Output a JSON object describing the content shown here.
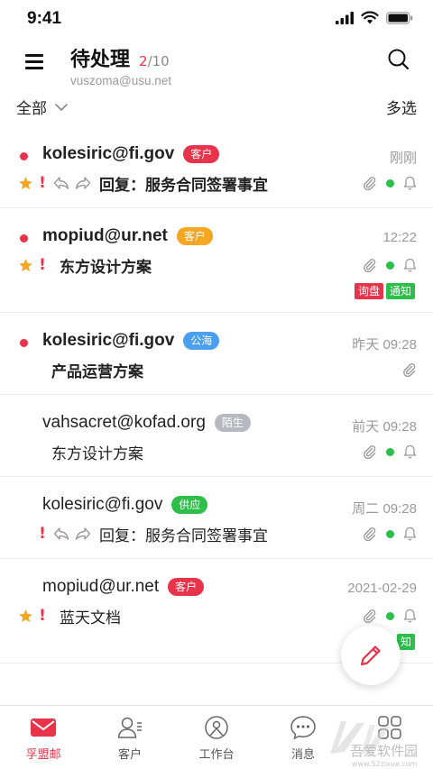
{
  "status_bar": {
    "time": "9:41"
  },
  "header": {
    "title": "待处理",
    "count_current": "2",
    "count_total": "/10",
    "account": "vuszoma@usu.net"
  },
  "filter": {
    "scope_label": "全部",
    "multi_select_label": "多选"
  },
  "colors": {
    "accent": "#e8334a",
    "green": "#2bbf4a",
    "orange": "#f5a623",
    "blue": "#4a9ff0",
    "grey": "#b8b8c0"
  },
  "mails": [
    {
      "sender": "kolesiric@fi.gov",
      "tag": "客户",
      "tag_color": "#e8334a",
      "time": "刚刚",
      "subject": "回复：服务合同签署事宜",
      "unread": true,
      "starred": true,
      "flagged": true,
      "reply_fwd": true,
      "status_dot": true,
      "bell": true,
      "badges": []
    },
    {
      "sender": "mopiud@ur.net",
      "tag": "客户",
      "tag_color": "#f5a623",
      "time": "12:22",
      "subject": "东方设计方案",
      "unread": true,
      "starred": true,
      "flagged": true,
      "reply_fwd": false,
      "status_dot": true,
      "bell": true,
      "badges": [
        {
          "label": "询盘",
          "color": "#e8334a"
        },
        {
          "label": "通知",
          "color": "#2bbf4a"
        }
      ]
    },
    {
      "sender": "kolesiric@fi.gov",
      "tag": "公海",
      "tag_color": "#4a9ff0",
      "time": "昨天 09:28",
      "subject": "产品运营方案",
      "unread": true,
      "starred": false,
      "flagged": false,
      "reply_fwd": false,
      "status_dot": false,
      "bell": false,
      "badges": []
    },
    {
      "sender": "vahsacret@kofad.org",
      "tag": "陌生",
      "tag_color": "#b8b8c0",
      "time": "前天 09:28",
      "subject": "东方设计方案",
      "unread": false,
      "starred": false,
      "flagged": false,
      "reply_fwd": false,
      "status_dot": true,
      "bell": true,
      "badges": []
    },
    {
      "sender": "kolesiric@fi.gov",
      "tag": "供应",
      "tag_color": "#2bbf4a",
      "time": "周二 09:28",
      "subject": "回复：服务合同签署事宜",
      "unread": false,
      "starred": false,
      "flagged": true,
      "reply_fwd": true,
      "status_dot": true,
      "bell": true,
      "badges": []
    },
    {
      "sender": "mopiud@ur.net",
      "tag": "客户",
      "tag_color": "#e8334a",
      "time": "2021-02-29",
      "subject": "蓝天文档",
      "unread": false,
      "starred": true,
      "flagged": true,
      "reply_fwd": false,
      "status_dot": true,
      "bell": true,
      "badges": [
        {
          "label": "知",
          "color": "#2bbf4a"
        }
      ]
    }
  ],
  "tabs": [
    {
      "label": "孚盟邮",
      "icon": "mail-icon",
      "active": true
    },
    {
      "label": "客户",
      "icon": "customer-icon",
      "active": false
    },
    {
      "label": "工作台",
      "icon": "workbench-icon",
      "active": false
    },
    {
      "label": "消息",
      "icon": "message-icon",
      "active": false
    },
    {
      "label": "",
      "icon": "apps-icon",
      "active": false
    }
  ],
  "watermark": {
    "line1": "吾爱软件园",
    "line2": "www.52zixue.com"
  }
}
